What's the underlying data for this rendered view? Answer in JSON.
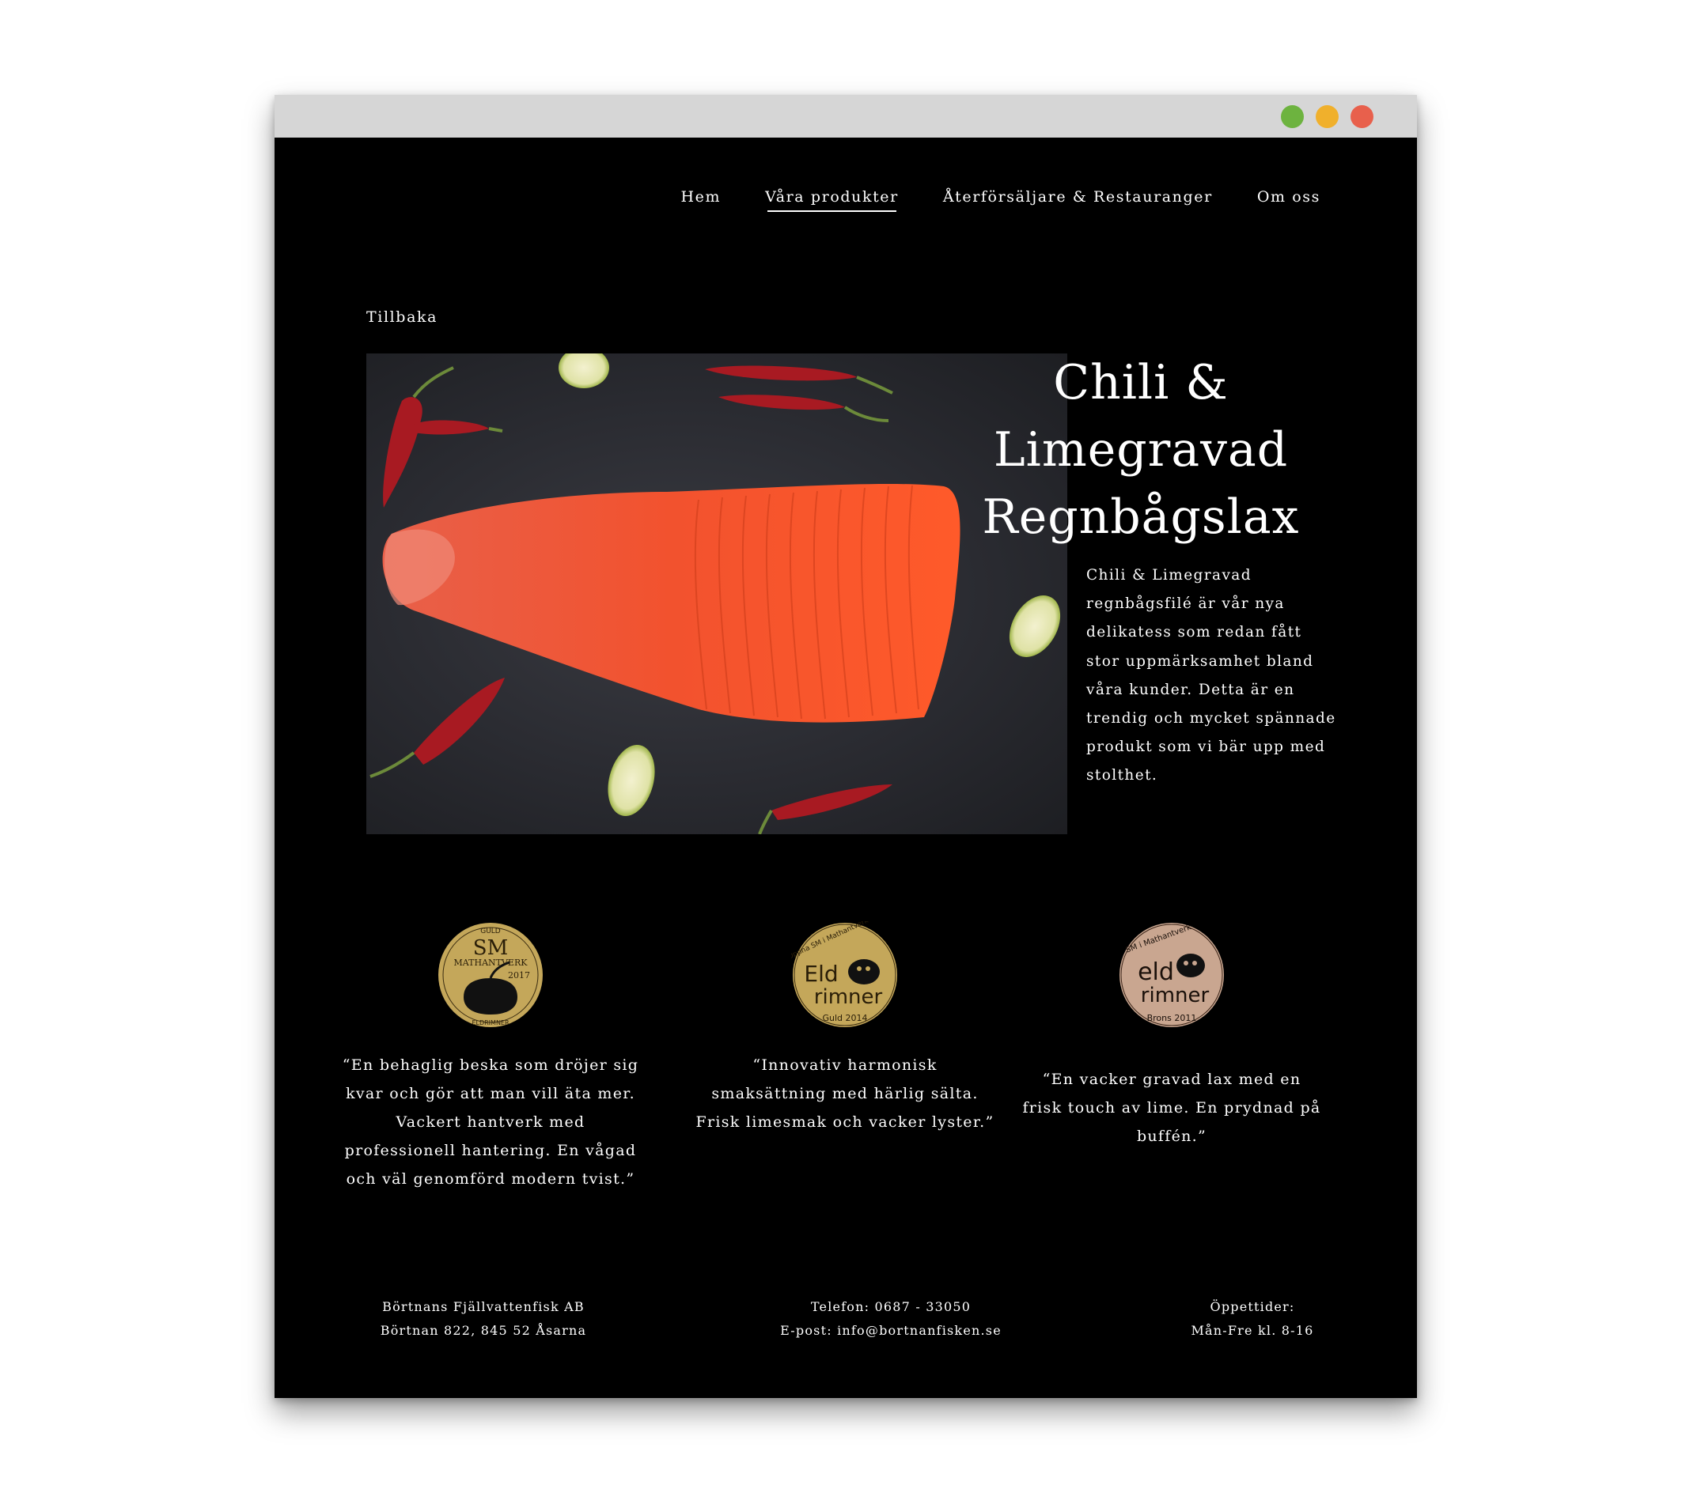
{
  "nav": {
    "items": [
      {
        "label": "Hem"
      },
      {
        "label": "Våra produkter",
        "active": true
      },
      {
        "label": "Återförsäljare & Restauranger"
      },
      {
        "label": "Om oss"
      }
    ]
  },
  "back_label": "Tillbaka",
  "product": {
    "title": "Chili & Limegravad Regnbågslax",
    "description": "Chili & Limegravad regnbågsfilé är vår nya delikatess som redan fått stor uppmärksamhet bland våra kunder. Detta är en trendig och mycket spännade produkt som vi bär upp med stolthet."
  },
  "awards": [
    {
      "medal_texts": [
        "GULD",
        "SM",
        "MATHANTVERK",
        "2017",
        "ELDRIMNER"
      ],
      "quote": "“En behaglig beska som dröjer sig kvar och gör att man vill äta mer. Vackert hantverk med professionell hantering. En vågad och väl genomförd modern tvist.”"
    },
    {
      "medal_texts": [
        "Öppna SM i Mathantverk",
        "Eld",
        "rimner",
        "Guld 2014"
      ],
      "quote": "“Innovativ harmonisk smaksättning med härlig sälta. Frisk limesmak och vacker lyster.”"
    },
    {
      "medal_texts": [
        "SM i Mathantverk",
        "eld",
        "rimner",
        "Brons 2011"
      ],
      "quote": "“En vacker gravad lax med en frisk touch av lime. En prydnad på buffén.”"
    }
  ],
  "footer": {
    "company": "Börtnans Fjällvattenfisk AB",
    "address": "Börtnan 822, 845 52 Åsarna",
    "phone": "Telefon: 0687 - 33050",
    "email": "E-post: info@bortnanfisken.se",
    "hours_label": "Öppettider:",
    "hours": "Mån-Fre kl. 8-16"
  },
  "colors": {
    "background": "#000000",
    "titlebar": "#d6d6d6",
    "dot_green": "#6db33f",
    "dot_yellow": "#f0b02c",
    "dot_red": "#e8604c",
    "gold_medal": "#c4a75a",
    "bronze_medal": "#c9a690"
  }
}
